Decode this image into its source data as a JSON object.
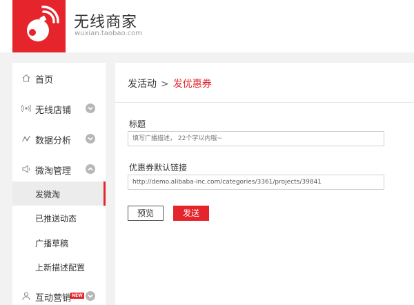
{
  "brand": {
    "title": "无线商家",
    "subtitle": "wuxian.taobao.com",
    "accent_color": "#e5242b",
    "logo_icon": "wifi-bomb-logo"
  },
  "sidebar": {
    "items": [
      {
        "label": "首页",
        "icon": "home-icon"
      },
      {
        "label": "无线店铺",
        "icon": "wireless-icon",
        "expandable": true
      },
      {
        "label": "数据分析",
        "icon": "analytics-icon",
        "expandable": true
      },
      {
        "label": "微淘管理",
        "icon": "speaker-icon",
        "expandable": true,
        "expanded": true
      },
      {
        "label": "互动营销",
        "icon": "user-icon",
        "expandable": true,
        "badge": "NEW"
      }
    ],
    "sub_items": [
      {
        "label": "发微淘",
        "active": true
      },
      {
        "label": "已推送动态"
      },
      {
        "label": "广播草稿"
      },
      {
        "label": "上新描述配置"
      }
    ]
  },
  "main": {
    "breadcrumb": {
      "parent": "发活动",
      "separator": ">",
      "current": "发优惠券"
    },
    "title_field": {
      "label": "标题",
      "placeholder": "填写广播描述， 22个字以内哦~"
    },
    "link_field": {
      "label": "优惠券默认链接",
      "value": "http://demo.alibaba-inc.com/categories/3361/projects/39841"
    },
    "buttons": {
      "preview": "预览",
      "send": "发送"
    }
  }
}
